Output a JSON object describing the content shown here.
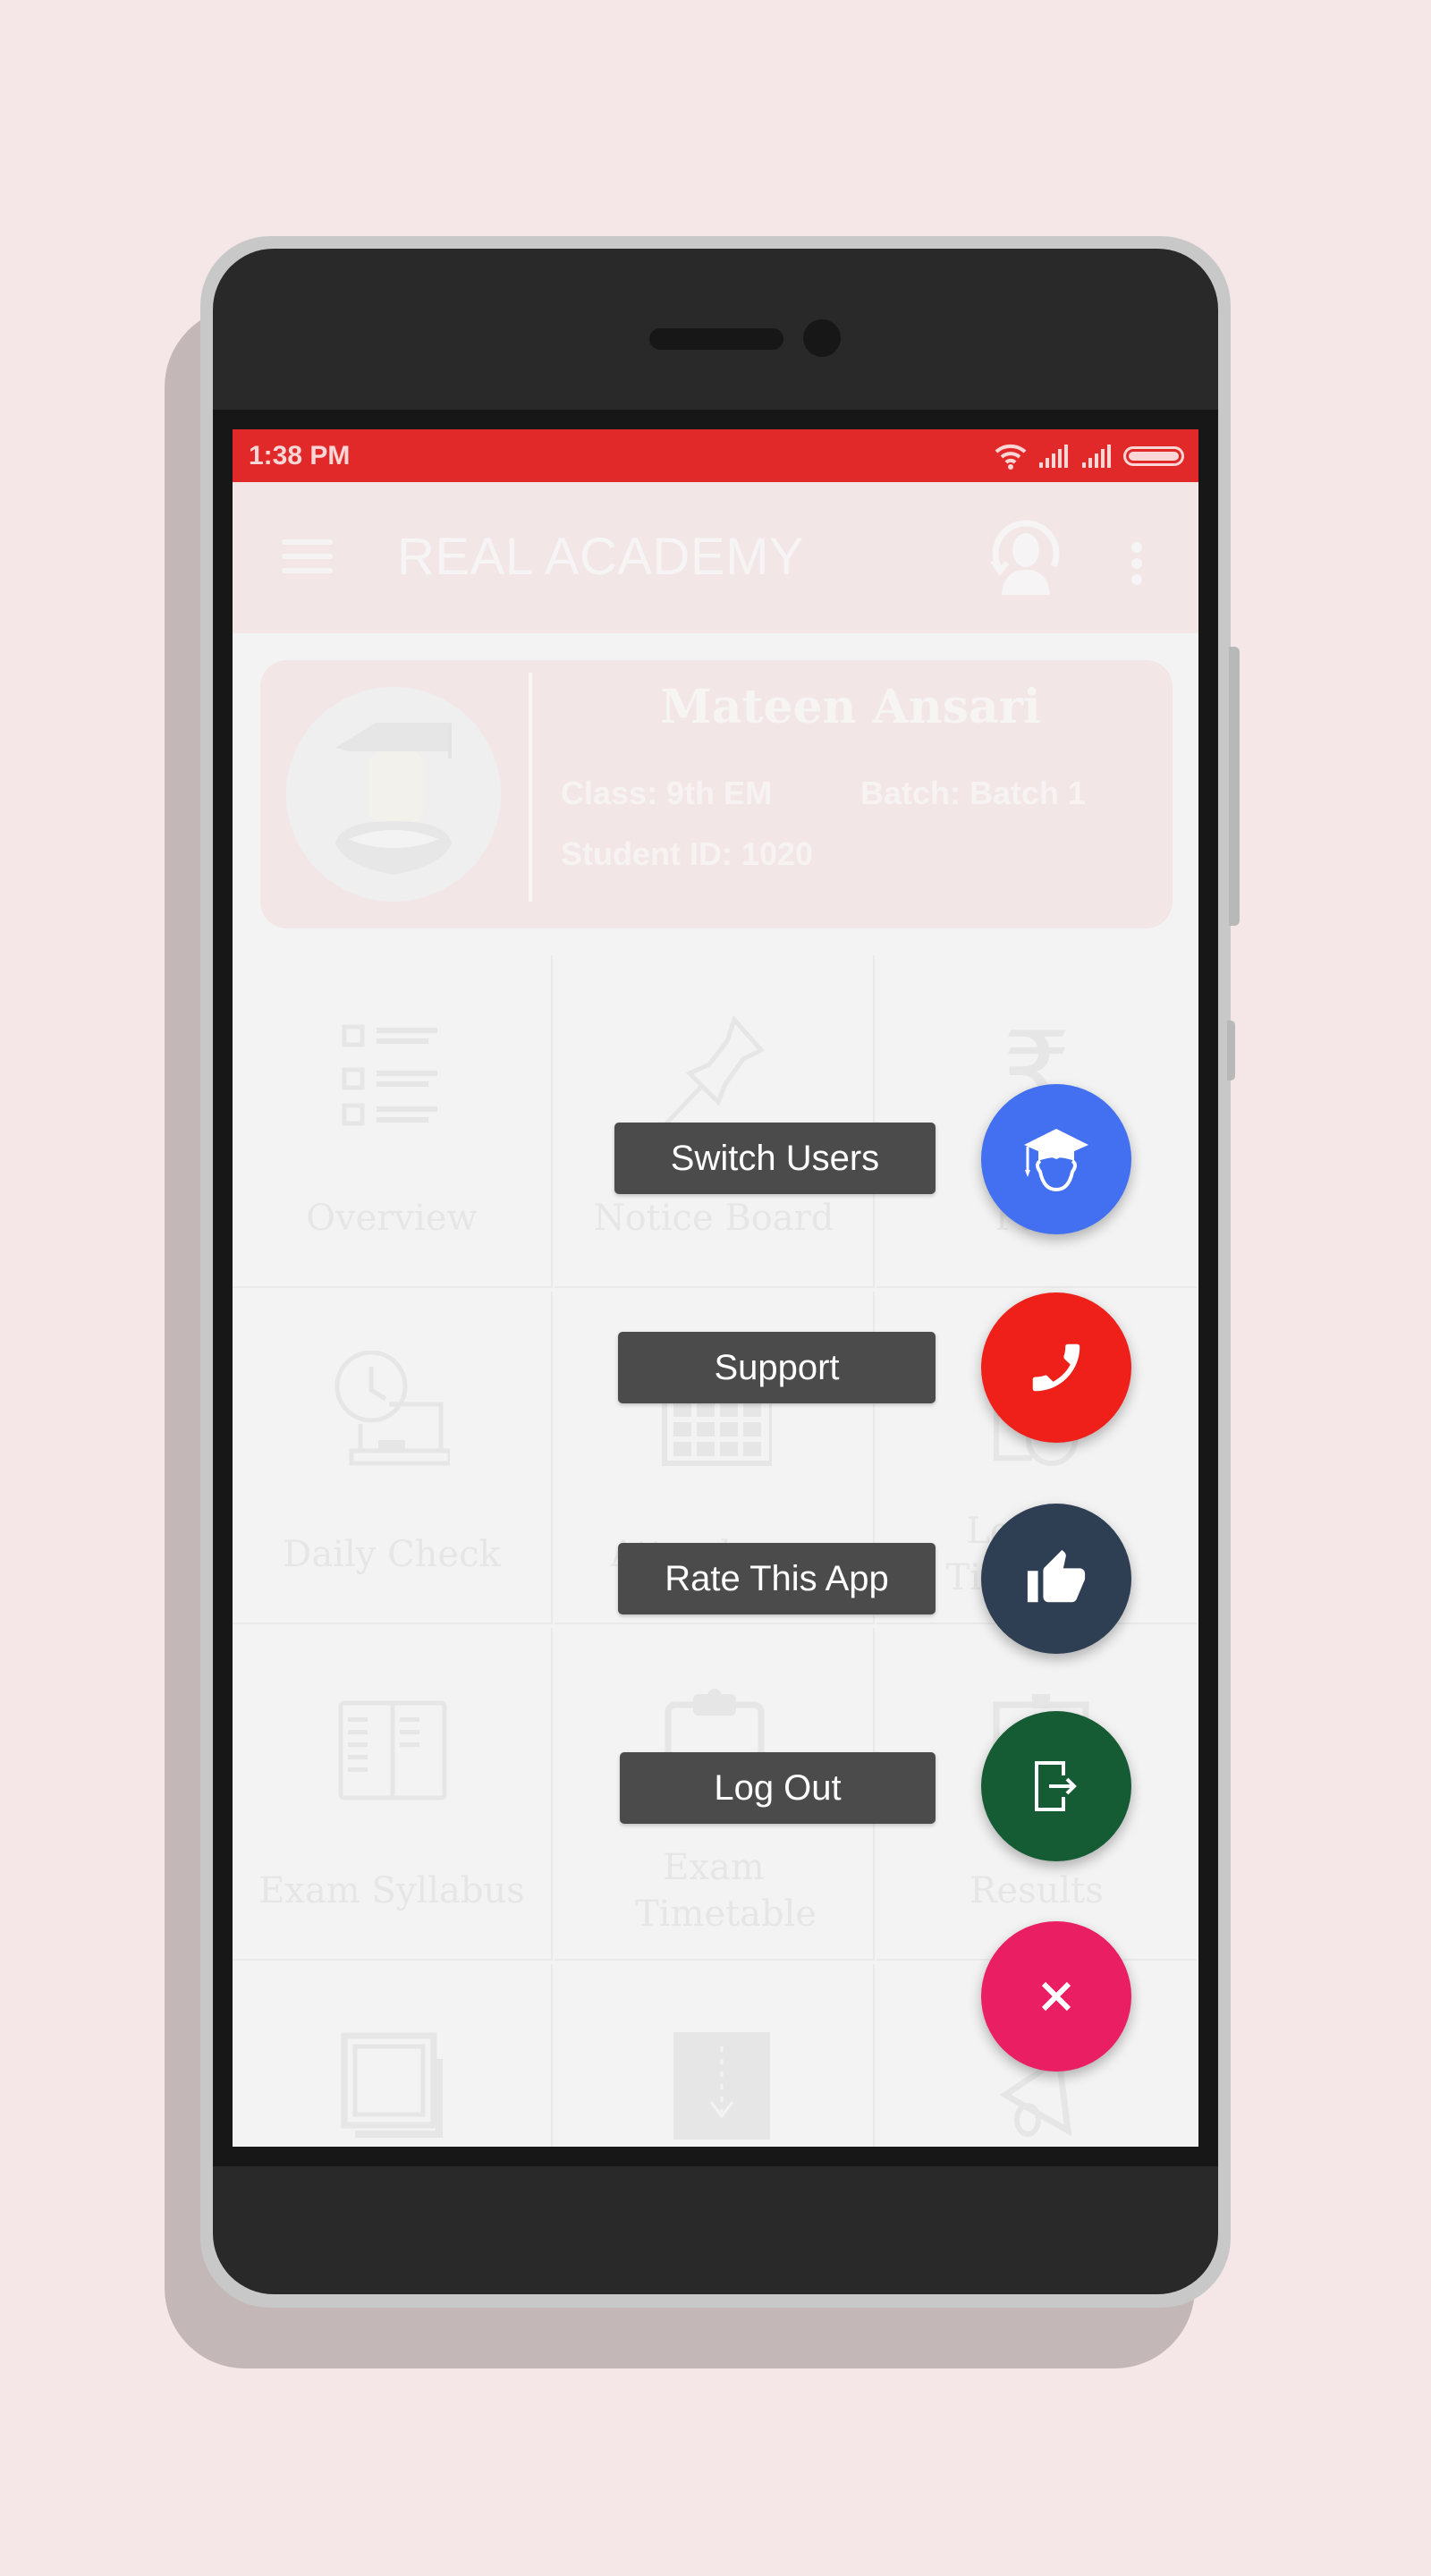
{
  "status_bar": {
    "time": "1:38 PM",
    "icons": [
      "wifi-icon",
      "signal-icon",
      "signal-icon",
      "battery-icon"
    ]
  },
  "app_bar": {
    "title": "REAL ACADEMY",
    "menu_icon": "hamburger-icon",
    "account_icon": "account-switch-icon",
    "overflow_icon": "kebab-menu-icon"
  },
  "profile": {
    "name": "Mateen Ansari",
    "class_text": "Class: 9th EM",
    "batch_text": "Batch: Batch 1",
    "student_id_text": "Student ID: 1020",
    "avatar_icon": "graduate-avatar"
  },
  "grid": {
    "items": [
      {
        "label": "Overview",
        "icon": "checklist-icon"
      },
      {
        "label": "Notice Board",
        "icon": "pushpin-icon"
      },
      {
        "label": "Fees",
        "icon": "rupee-icon"
      },
      {
        "label": "Daily Check",
        "icon": "clock-board-icon"
      },
      {
        "label": "Attendance",
        "icon": "calendar-icon"
      },
      {
        "label": "Lecture Timetable",
        "icon": "timetable-icon"
      },
      {
        "label": "Exam Syllabus",
        "icon": "open-book-icon"
      },
      {
        "label": "Exam Timetable",
        "icon": "clipboard-icon"
      },
      {
        "label": "Results",
        "icon": "results-icon"
      },
      {
        "label": "",
        "icon": "gallery-icon"
      },
      {
        "label": "",
        "icon": "download-book-icon"
      },
      {
        "label": "",
        "icon": "megaphone-icon"
      }
    ]
  },
  "fab_menu": {
    "actions": [
      {
        "label": "Switch Users",
        "icon": "graduate-user-icon",
        "color": "#4270f0"
      },
      {
        "label": "Support",
        "icon": "phone-icon",
        "color": "#ee2019"
      },
      {
        "label": "Rate This App",
        "icon": "thumbs-up-icon",
        "color": "#2e3e53"
      },
      {
        "label": "Log Out",
        "icon": "logout-icon",
        "color": "#155c35"
      }
    ],
    "close": {
      "icon": "close-icon",
      "color": "#e91e63"
    }
  },
  "colors": {
    "status_bar": "#e22929",
    "app_bar": "#f2e6e7",
    "page_background": "#f5e6e7",
    "fab_label_bg": "#4b4b4b"
  }
}
